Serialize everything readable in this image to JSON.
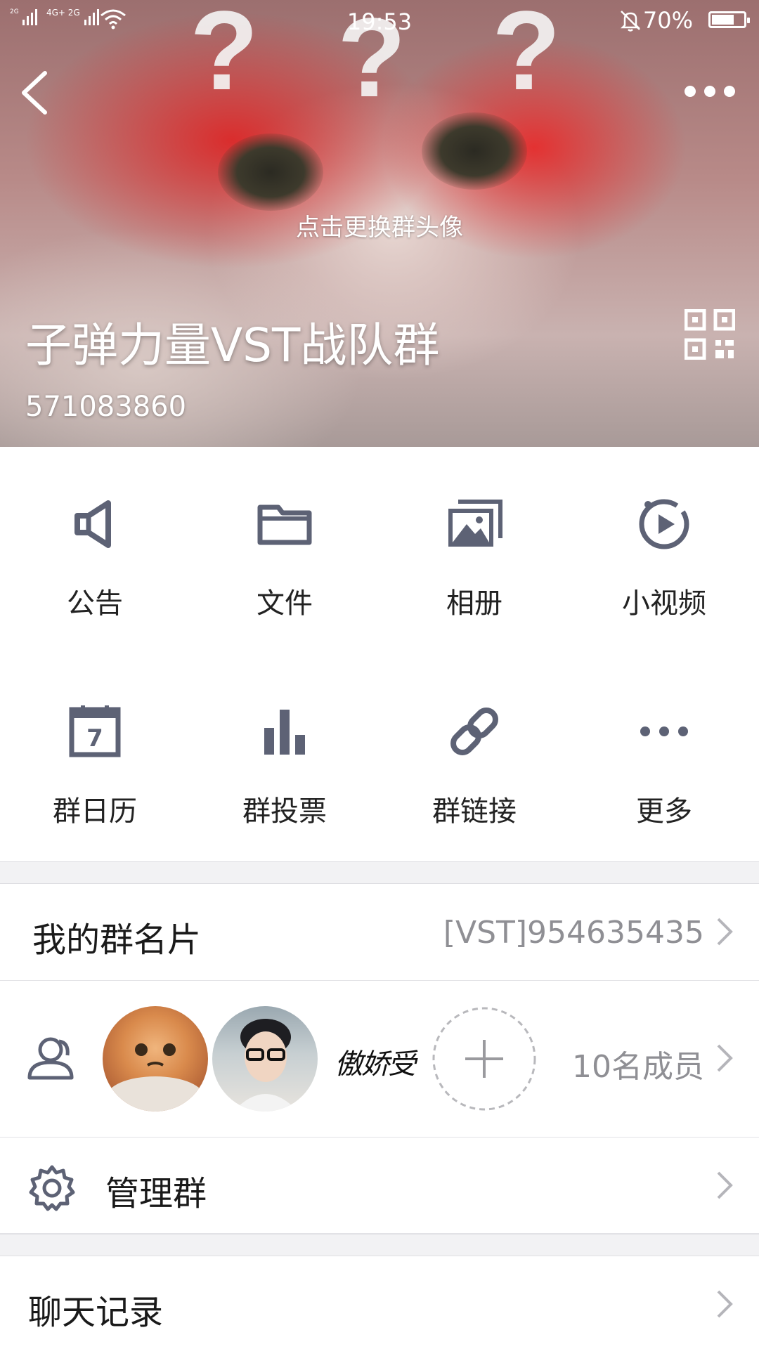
{
  "status_bar": {
    "signal_1": "2G",
    "signal_2": "4G+ 2G",
    "time": "19:53",
    "battery_percent": "70%",
    "battery_level": 0.7
  },
  "header": {
    "change_avatar_hint": "点击更换群头像",
    "group_name": "子弹力量VST战队群",
    "group_id": "571083860"
  },
  "features": [
    {
      "label": "公告",
      "icon": "megaphone-icon"
    },
    {
      "label": "文件",
      "icon": "folder-icon"
    },
    {
      "label": "相册",
      "icon": "photo-album-icon"
    },
    {
      "label": "小视频",
      "icon": "video-play-icon"
    },
    {
      "label": "群日历",
      "icon": "calendar-icon",
      "icon_text": "7"
    },
    {
      "label": "群投票",
      "icon": "bar-chart-icon"
    },
    {
      "label": "群链接",
      "icon": "link-icon"
    },
    {
      "label": "更多",
      "icon": "more-dots-icon"
    }
  ],
  "my_card": {
    "label": "我的群名片",
    "value": "[VST]954635435"
  },
  "members": {
    "count_text": "10名成员",
    "avatars": [
      "cat-avatar",
      "man-glasses-avatar",
      "calligraphy-avatar"
    ],
    "calligraphy_text": "傲娇受"
  },
  "manage": {
    "label": "管理群"
  },
  "chat_history": {
    "label": "聊天记录"
  },
  "colors": {
    "icon_gray": "#5d6275",
    "text_primary": "#1a1a1a",
    "text_secondary": "#8f8f94",
    "divider": "#e3e3e6"
  }
}
